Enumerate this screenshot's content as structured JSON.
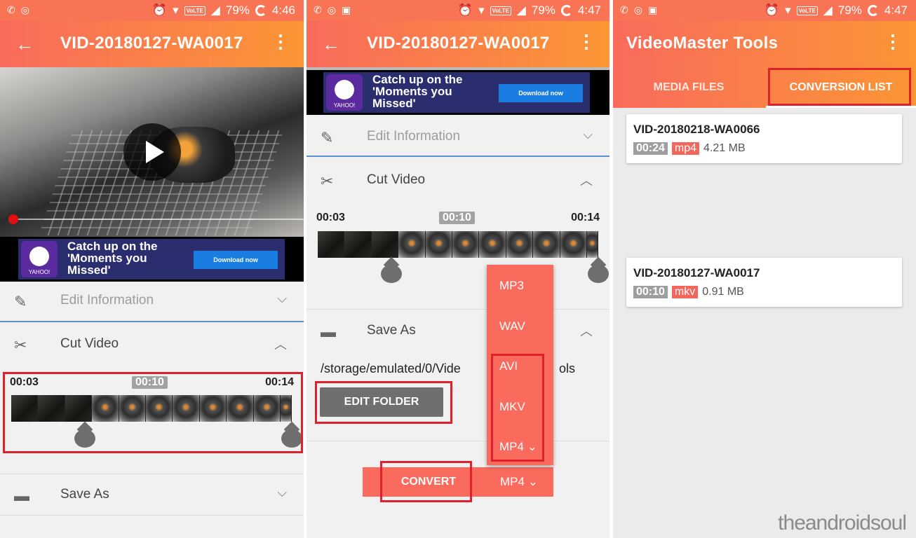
{
  "status": {
    "battery": "79%",
    "time_1": "4:46",
    "time_2": "4:47",
    "time_3": "4:47",
    "lte": "VoLTE"
  },
  "player": {
    "title": "VID-20180127-WA0017"
  },
  "ad": {
    "line1": "Catch up on the",
    "line2": "'Moments you",
    "line3": "Missed'",
    "download": "Download now",
    "brand": "YAHOO!"
  },
  "sections": {
    "edit_information": "Edit Information",
    "cut_video": "Cut Video",
    "save_as": "Save As"
  },
  "cut": {
    "start": "00:03",
    "current": "00:10",
    "end": "00:14"
  },
  "save": {
    "path": "/storage/emulated/0/Vide",
    "path_tail": "ols",
    "edit_folder": "EDIT FOLDER"
  },
  "convert": {
    "button": "CONVERT",
    "format": "MP4",
    "options": [
      "MP3",
      "WAV",
      "AVI",
      "MKV",
      "MP4"
    ]
  },
  "tools": {
    "title": "VideoMaster Tools",
    "tabs": [
      "MEDIA FILES",
      "CONVERSION LIST"
    ],
    "selected_tab": "CONVERSION LIST",
    "items": [
      {
        "name": "VID-20180218-WA0066",
        "duration": "00:24",
        "ext": "mp4",
        "size": "4.21 MB"
      },
      {
        "name": "VID-20180127-WA0017",
        "duration": "00:10",
        "ext": "mkv",
        "size": "0.91 MB"
      }
    ]
  },
  "watermark": "theandroidsoul",
  "colors": {
    "accent": "#f96b5c",
    "accent_end": "#fb9635",
    "highlight": "#e0212b"
  }
}
